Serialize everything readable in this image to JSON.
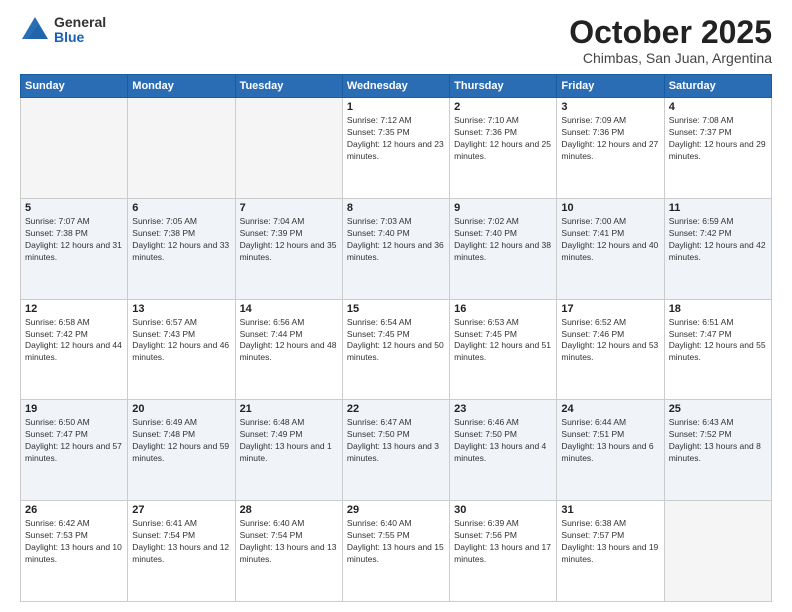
{
  "header": {
    "logo_general": "General",
    "logo_blue": "Blue",
    "month_title": "October 2025",
    "location": "Chimbas, San Juan, Argentina"
  },
  "weekdays": [
    "Sunday",
    "Monday",
    "Tuesday",
    "Wednesday",
    "Thursday",
    "Friday",
    "Saturday"
  ],
  "weeks": [
    [
      {
        "day": "",
        "sunrise": "",
        "sunset": "",
        "daylight": ""
      },
      {
        "day": "",
        "sunrise": "",
        "sunset": "",
        "daylight": ""
      },
      {
        "day": "",
        "sunrise": "",
        "sunset": "",
        "daylight": ""
      },
      {
        "day": "1",
        "sunrise": "Sunrise: 7:12 AM",
        "sunset": "Sunset: 7:35 PM",
        "daylight": "Daylight: 12 hours and 23 minutes."
      },
      {
        "day": "2",
        "sunrise": "Sunrise: 7:10 AM",
        "sunset": "Sunset: 7:36 PM",
        "daylight": "Daylight: 12 hours and 25 minutes."
      },
      {
        "day": "3",
        "sunrise": "Sunrise: 7:09 AM",
        "sunset": "Sunset: 7:36 PM",
        "daylight": "Daylight: 12 hours and 27 minutes."
      },
      {
        "day": "4",
        "sunrise": "Sunrise: 7:08 AM",
        "sunset": "Sunset: 7:37 PM",
        "daylight": "Daylight: 12 hours and 29 minutes."
      }
    ],
    [
      {
        "day": "5",
        "sunrise": "Sunrise: 7:07 AM",
        "sunset": "Sunset: 7:38 PM",
        "daylight": "Daylight: 12 hours and 31 minutes."
      },
      {
        "day": "6",
        "sunrise": "Sunrise: 7:05 AM",
        "sunset": "Sunset: 7:38 PM",
        "daylight": "Daylight: 12 hours and 33 minutes."
      },
      {
        "day": "7",
        "sunrise": "Sunrise: 7:04 AM",
        "sunset": "Sunset: 7:39 PM",
        "daylight": "Daylight: 12 hours and 35 minutes."
      },
      {
        "day": "8",
        "sunrise": "Sunrise: 7:03 AM",
        "sunset": "Sunset: 7:40 PM",
        "daylight": "Daylight: 12 hours and 36 minutes."
      },
      {
        "day": "9",
        "sunrise": "Sunrise: 7:02 AM",
        "sunset": "Sunset: 7:40 PM",
        "daylight": "Daylight: 12 hours and 38 minutes."
      },
      {
        "day": "10",
        "sunrise": "Sunrise: 7:00 AM",
        "sunset": "Sunset: 7:41 PM",
        "daylight": "Daylight: 12 hours and 40 minutes."
      },
      {
        "day": "11",
        "sunrise": "Sunrise: 6:59 AM",
        "sunset": "Sunset: 7:42 PM",
        "daylight": "Daylight: 12 hours and 42 minutes."
      }
    ],
    [
      {
        "day": "12",
        "sunrise": "Sunrise: 6:58 AM",
        "sunset": "Sunset: 7:42 PM",
        "daylight": "Daylight: 12 hours and 44 minutes."
      },
      {
        "day": "13",
        "sunrise": "Sunrise: 6:57 AM",
        "sunset": "Sunset: 7:43 PM",
        "daylight": "Daylight: 12 hours and 46 minutes."
      },
      {
        "day": "14",
        "sunrise": "Sunrise: 6:56 AM",
        "sunset": "Sunset: 7:44 PM",
        "daylight": "Daylight: 12 hours and 48 minutes."
      },
      {
        "day": "15",
        "sunrise": "Sunrise: 6:54 AM",
        "sunset": "Sunset: 7:45 PM",
        "daylight": "Daylight: 12 hours and 50 minutes."
      },
      {
        "day": "16",
        "sunrise": "Sunrise: 6:53 AM",
        "sunset": "Sunset: 7:45 PM",
        "daylight": "Daylight: 12 hours and 51 minutes."
      },
      {
        "day": "17",
        "sunrise": "Sunrise: 6:52 AM",
        "sunset": "Sunset: 7:46 PM",
        "daylight": "Daylight: 12 hours and 53 minutes."
      },
      {
        "day": "18",
        "sunrise": "Sunrise: 6:51 AM",
        "sunset": "Sunset: 7:47 PM",
        "daylight": "Daylight: 12 hours and 55 minutes."
      }
    ],
    [
      {
        "day": "19",
        "sunrise": "Sunrise: 6:50 AM",
        "sunset": "Sunset: 7:47 PM",
        "daylight": "Daylight: 12 hours and 57 minutes."
      },
      {
        "day": "20",
        "sunrise": "Sunrise: 6:49 AM",
        "sunset": "Sunset: 7:48 PM",
        "daylight": "Daylight: 12 hours and 59 minutes."
      },
      {
        "day": "21",
        "sunrise": "Sunrise: 6:48 AM",
        "sunset": "Sunset: 7:49 PM",
        "daylight": "Daylight: 13 hours and 1 minute."
      },
      {
        "day": "22",
        "sunrise": "Sunrise: 6:47 AM",
        "sunset": "Sunset: 7:50 PM",
        "daylight": "Daylight: 13 hours and 3 minutes."
      },
      {
        "day": "23",
        "sunrise": "Sunrise: 6:46 AM",
        "sunset": "Sunset: 7:50 PM",
        "daylight": "Daylight: 13 hours and 4 minutes."
      },
      {
        "day": "24",
        "sunrise": "Sunrise: 6:44 AM",
        "sunset": "Sunset: 7:51 PM",
        "daylight": "Daylight: 13 hours and 6 minutes."
      },
      {
        "day": "25",
        "sunrise": "Sunrise: 6:43 AM",
        "sunset": "Sunset: 7:52 PM",
        "daylight": "Daylight: 13 hours and 8 minutes."
      }
    ],
    [
      {
        "day": "26",
        "sunrise": "Sunrise: 6:42 AM",
        "sunset": "Sunset: 7:53 PM",
        "daylight": "Daylight: 13 hours and 10 minutes."
      },
      {
        "day": "27",
        "sunrise": "Sunrise: 6:41 AM",
        "sunset": "Sunset: 7:54 PM",
        "daylight": "Daylight: 13 hours and 12 minutes."
      },
      {
        "day": "28",
        "sunrise": "Sunrise: 6:40 AM",
        "sunset": "Sunset: 7:54 PM",
        "daylight": "Daylight: 13 hours and 13 minutes."
      },
      {
        "day": "29",
        "sunrise": "Sunrise: 6:40 AM",
        "sunset": "Sunset: 7:55 PM",
        "daylight": "Daylight: 13 hours and 15 minutes."
      },
      {
        "day": "30",
        "sunrise": "Sunrise: 6:39 AM",
        "sunset": "Sunset: 7:56 PM",
        "daylight": "Daylight: 13 hours and 17 minutes."
      },
      {
        "day": "31",
        "sunrise": "Sunrise: 6:38 AM",
        "sunset": "Sunset: 7:57 PM",
        "daylight": "Daylight: 13 hours and 19 minutes."
      },
      {
        "day": "",
        "sunrise": "",
        "sunset": "",
        "daylight": ""
      }
    ]
  ]
}
